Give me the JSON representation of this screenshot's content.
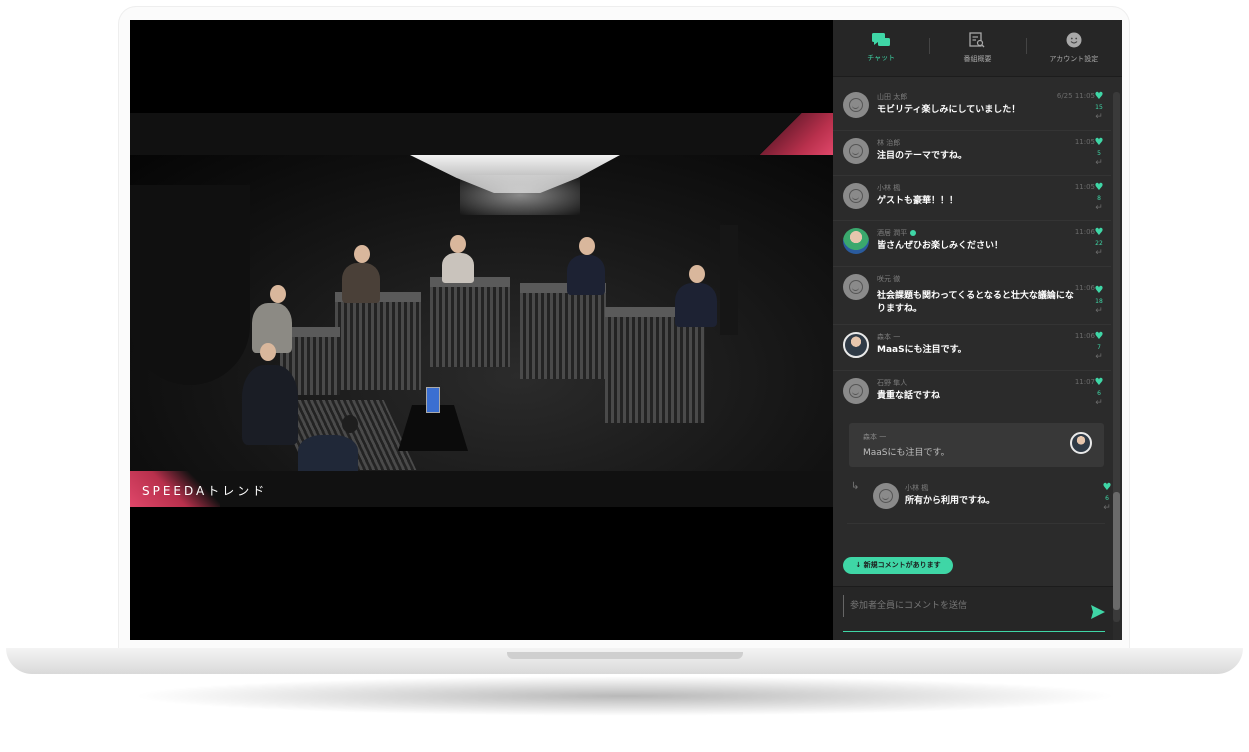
{
  "video": {
    "brand": "SPEEDAトレンド"
  },
  "tabs": [
    {
      "label": "チャット",
      "icon": "chat-icon",
      "active": true
    },
    {
      "label": "番組概要",
      "icon": "document-search-icon",
      "active": false
    },
    {
      "label": "アカウント設定",
      "icon": "account-icon",
      "active": false
    }
  ],
  "comments": [
    {
      "name": "山田 太郎",
      "time": "6/25  11:05",
      "text": "モビリティ楽しみにしていました！",
      "likes": "15"
    },
    {
      "name": "林 治郎",
      "time": "11:05",
      "text": "注目のテーマですね。",
      "likes": "5"
    },
    {
      "name": "小林 楓",
      "time": "11:05",
      "text": "ゲストも豪華！！！",
      "likes": "8"
    },
    {
      "name": "酒居 潤平",
      "time": "11:06",
      "text": "皆さんぜひお楽しみください！",
      "likes": "22"
    },
    {
      "name": "咲元 徹",
      "time": "11:06",
      "text": "社会課題も関わってくるとなると壮大な議論になりますね。",
      "likes": "18"
    },
    {
      "name": "森本 一",
      "time": "11:06",
      "text": "MaaSにも注目です。",
      "likes": "7"
    },
    {
      "name": "石野 隼人",
      "time": "11:07",
      "text": "貴重な話ですね",
      "likes": "6"
    }
  ],
  "quote": {
    "name": "森本 一",
    "text": "MaaSにも注目です。"
  },
  "reply": {
    "name": "小林 楓",
    "text": "所有から利用ですね。",
    "likes": "6"
  },
  "new_comments_label": "↓ 新規コメントがあります",
  "input": {
    "placeholder": "参加者全員にコメントを送信"
  },
  "colors": {
    "accent": "#3fd6a6",
    "panel": "#2b2b2b",
    "brand_red": "#e0476a"
  }
}
